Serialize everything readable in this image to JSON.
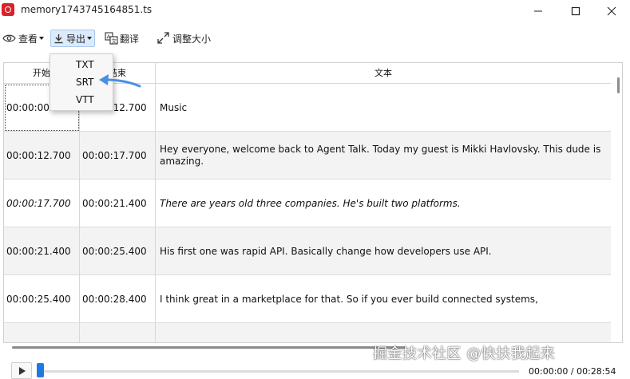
{
  "window": {
    "title": "memory1743745164851.ts"
  },
  "toolbar": {
    "view_label": "查看",
    "export_label": "导出",
    "translate_label": "翻译",
    "resize_label": "调整大小"
  },
  "export_menu": {
    "items": [
      "TXT",
      "SRT",
      "VTT"
    ]
  },
  "table": {
    "columns": [
      "开始",
      "结束",
      "文本"
    ],
    "rows": [
      {
        "start": "00:00:00.0",
        "end": "00:00:12.700",
        "text": "Music"
      },
      {
        "start": "00:00:12.700",
        "end": "00:00:17.700",
        "text": "Hey everyone, welcome back to Agent Talk. Today my guest is Mikki Havlovsky. This dude is amazing."
      },
      {
        "start": "00:00:17.700",
        "end": "00:00:21.400",
        "text": "There are years old three companies. He's built two platforms."
      },
      {
        "start": "00:00:21.400",
        "end": "00:00:25.400",
        "text": "His first one was rapid API. Basically change how developers use API."
      },
      {
        "start": "00:00:25.400",
        "end": "00:00:28.400",
        "text": "I think great in a marketplace for that. So if you ever build connected systems,"
      }
    ]
  },
  "player": {
    "current_time": "00:00:00",
    "total_time": "00:28:54",
    "separator": " / "
  },
  "watermark": {
    "text": "掘金技术社区 @快扶我起来"
  },
  "colors": {
    "accent": "#1e7ae0",
    "app_icon": "#d9222a",
    "export_highlight": "#dcebfb",
    "annotation_arrow": "#4a90e2"
  }
}
